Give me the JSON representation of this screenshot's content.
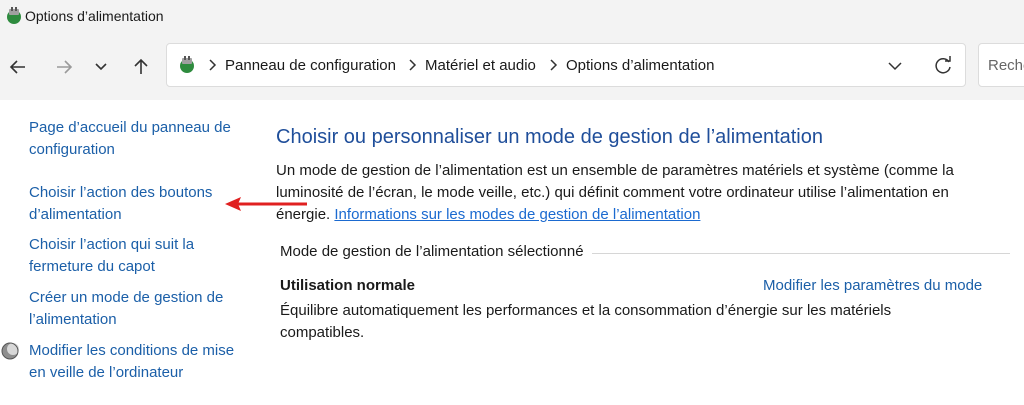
{
  "window": {
    "title": "Options d’alimentation"
  },
  "address": {
    "crumbs": [
      "Panneau de configuration",
      "Matériel et audio",
      "Options d’alimentation"
    ]
  },
  "search": {
    "placeholder": "Reche"
  },
  "sidebar": {
    "items": [
      {
        "label": "Page d’accueil du panneau de configuration"
      },
      {
        "label": "Choisir l’action des boutons d’alimentation"
      },
      {
        "label": "Choisir l’action qui suit la fermeture du capot"
      },
      {
        "label": "Créer un mode de gestion de l’alimentation"
      },
      {
        "label": "Modifier les conditions de mise en veille de l’ordinateur"
      }
    ]
  },
  "main": {
    "title": "Choisir ou personnaliser un mode de gestion de l’alimentation",
    "description": "Un mode de gestion de l’alimentation est un ensemble de paramètres matériels et système (comme la luminosité de l’écran, le mode veille, etc.) qui définit comment votre ordinateur utilise l’alimentation en énergie.",
    "info_link": "Informations sur les modes de gestion de l’alimentation",
    "section_label": "Mode de gestion de l’alimentation sélectionné",
    "plan": {
      "name": "Utilisation normale",
      "change_link": "Modifier les paramètres du mode",
      "description": "Équilibre automatiquement les performances et la consommation d’énergie sur les matériels compatibles."
    }
  },
  "colors": {
    "link": "#1b5fa8",
    "title": "#1f4e9a",
    "arrow": "#e02020"
  },
  "icons": [
    "power-options-icon",
    "back-arrow-icon",
    "forward-arrow-icon",
    "recent-dropdown-icon",
    "up-arrow-icon",
    "refresh-icon",
    "moon-icon"
  ]
}
